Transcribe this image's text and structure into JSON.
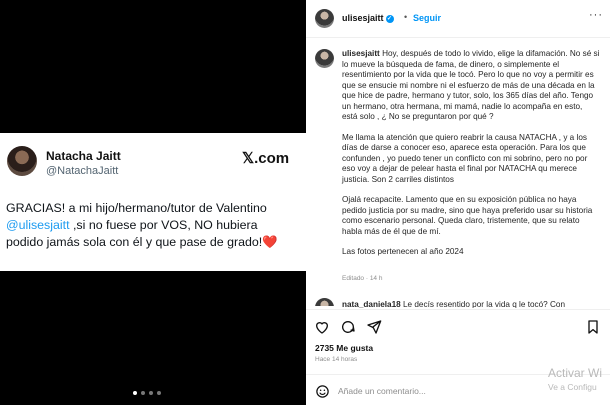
{
  "tweet": {
    "name": "Natacha Jaitt",
    "handle": "@NatachaJaitt",
    "logo_text": "𝕏.com",
    "line1": "GRACIAS! a mi hijo/hermano/tutor de Valentino",
    "mention": "@ulisesjaitt",
    "line2": " ,si no fuese por VOS, NO hubiera",
    "line3": "podido jamás sola con él y que pase de grado!",
    "heart": "❤️"
  },
  "header": {
    "username": "ulisesjaitt",
    "verified_mark": "✓",
    "separator": "•",
    "follow_label": "Seguir",
    "more_label": "···"
  },
  "caption": {
    "username": "ulisesjaitt",
    "p1": "Hoy, después de todo lo vivido, elige la difamación. No sé si lo mueve la búsqueda de fama, de dinero, o simplemente el resentimiento por la vida que le tocó. Pero lo que no voy a permitir es que se ensucie mi nombre ni el esfuerzo de más de una década en la que hice de padre, hermano y tutor, solo, los 365 días del año. Tengo un hermano, otra hermana, mi mamá, nadie lo acompaña en esto, está solo , ¿ No se preguntaron por qué ?",
    "p2": "Me llama la atención que quiero reabrir la causa NATACHA , y a los días de darse a conocer eso, aparece esta operación. Para los que confunden , yo puedo tener un conflicto con mi sobrino, pero no por eso voy a dejar de pelear hasta el final por NATACHA qu merece justicia. Son 2 carriles distintos",
    "p3": "Ojalá recapacite. Lamento que en su exposición pública no haya pedido justicia por su madre, sino que haya preferido usar su historia como escenario personal. Queda claro, tristemente, que su relato habla más de él que de mí.",
    "p4": "Las fotos pertenecen al año 2024",
    "edited": "Editado · 14 h"
  },
  "comment": {
    "username": "nata_daniela18",
    "text": "Le decís resentido por la vida q le tocó? Con"
  },
  "stats": {
    "likes": "2735 Me gusta",
    "time_ago": "Hace 14 horas"
  },
  "comment_input": {
    "placeholder": "Añade un comentario..."
  },
  "watermark": {
    "line1": "Activar Wi",
    "line2": "Ve a Configu"
  }
}
